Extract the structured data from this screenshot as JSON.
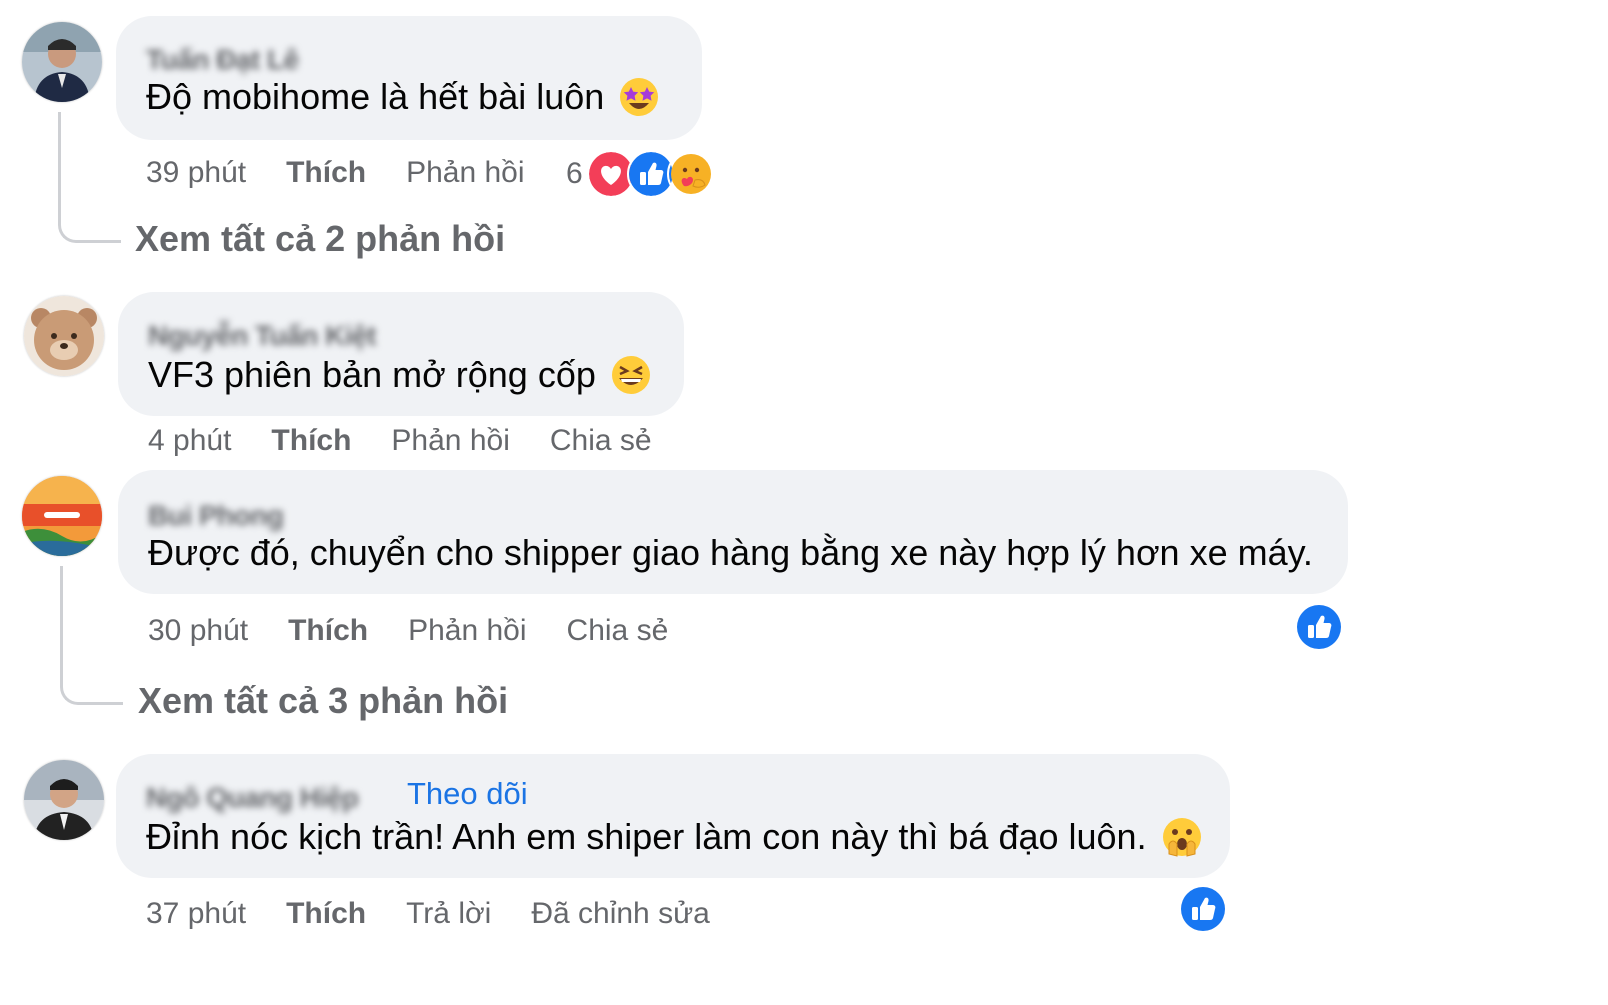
{
  "comments": [
    {
      "author": "Tuấn Đạt Lê",
      "text": "Độ mobihome là hết bài luôn",
      "emoji": "star-struck-emoji",
      "time": "39 phút",
      "like": "Thích",
      "reply": "Phản hồi",
      "reaction_count": "6",
      "reactions": [
        "love-reaction-icon",
        "like-reaction-icon",
        "care-reaction-icon"
      ],
      "view_replies": "Xem tất cả 2 phản hồi"
    },
    {
      "author": "Nguyễn Tuấn Kiệt",
      "text": "VF3 phiên bản mở rộng cốp",
      "emoji": "grinning-squinting-emoji",
      "time": "4 phút",
      "like": "Thích",
      "reply": "Phản hồi",
      "share": "Chia sẻ"
    },
    {
      "author": "Bui Phong",
      "text": "Được đó, chuyển cho shipper giao hàng bằng xe này hợp lý hơn xe máy.",
      "time": "30 phút",
      "like": "Thích",
      "reply": "Phản hồi",
      "share": "Chia sẻ",
      "reactions": [
        "like-reaction-icon"
      ],
      "view_replies": "Xem tất cả 3 phản hồi"
    },
    {
      "author": "Ngô Quang Hiệp",
      "follow": "Theo dõi",
      "text": "Đỉnh nóc kịch trần! Anh em shiper làm con này thì bá đạo luôn.",
      "emoji": "face-with-hand-over-mouth-emoji",
      "time": "37 phút",
      "like": "Thích",
      "reply": "Trả lời",
      "edited": "Đã chỉnh sửa",
      "reactions": [
        "like-reaction-icon"
      ]
    }
  ],
  "colors": {
    "bubble": "#f0f2f5",
    "meta_text": "#65676b",
    "link_blue": "#1b74e4",
    "like_blue": "#1877f2",
    "love_red": "#f33e58"
  }
}
